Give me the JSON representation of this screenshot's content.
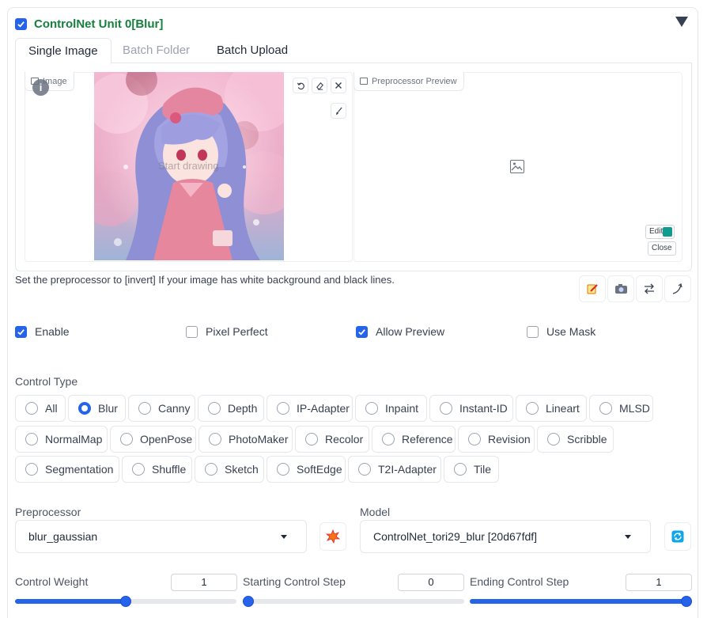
{
  "unit": {
    "enabled": true,
    "title": "ControlNet Unit 0[Blur]"
  },
  "tabs": [
    {
      "label": "Single Image",
      "state": "active"
    },
    {
      "label": "Batch Folder",
      "state": "disabled"
    },
    {
      "label": "Batch Upload",
      "state": "normal"
    }
  ],
  "image_panel": {
    "label": "Image",
    "info_badge": "i",
    "canvas_hint": "Start drawing",
    "tools": [
      "undo-icon",
      "eraser-icon",
      "close-icon",
      "brush-icon"
    ]
  },
  "preview_panel": {
    "label": "Preprocessor Preview",
    "edit_label": "Edit",
    "close_label": "Close"
  },
  "hint_text": "Set the preprocessor to [invert] If your image has white background and black lines.",
  "actions": [
    "edit-icon",
    "camera-icon",
    "swap-icon",
    "curve-icon"
  ],
  "options": {
    "enable": {
      "label": "Enable",
      "checked": true
    },
    "pixel_perfect": {
      "label": "Pixel Perfect",
      "checked": false
    },
    "allow_preview": {
      "label": "Allow Preview",
      "checked": true
    },
    "use_mask": {
      "label": "Use Mask",
      "checked": false
    }
  },
  "control_type": {
    "label": "Control Type",
    "selected": "Blur",
    "rows": [
      [
        "All",
        "Blur",
        "Canny",
        "Depth",
        "IP-Adapter",
        "Inpaint",
        "Instant-ID",
        "Lineart",
        "MLSD"
      ],
      [
        "NormalMap",
        "OpenPose",
        "PhotoMaker",
        "Recolor",
        "Reference",
        "Revision",
        "Scribble"
      ],
      [
        "Segmentation",
        "Shuffle",
        "Sketch",
        "SoftEdge",
        "T2I-Adapter",
        "Tile"
      ]
    ]
  },
  "preprocessor": {
    "label": "Preprocessor",
    "value": "blur_gaussian"
  },
  "model": {
    "label": "Model",
    "value": "ControlNet_tori29_blur [20d67fdf]"
  },
  "sliders": {
    "control_weight": {
      "label": "Control Weight",
      "value": "1",
      "fraction": 0.5
    },
    "starting_step": {
      "label": "Starting Control Step",
      "value": "0",
      "fraction": 0.0
    },
    "ending_step": {
      "label": "Ending Control Step",
      "value": "1",
      "fraction": 1.0
    }
  },
  "colors": {
    "accent": "#2563eb",
    "title_green": "#15803d"
  }
}
